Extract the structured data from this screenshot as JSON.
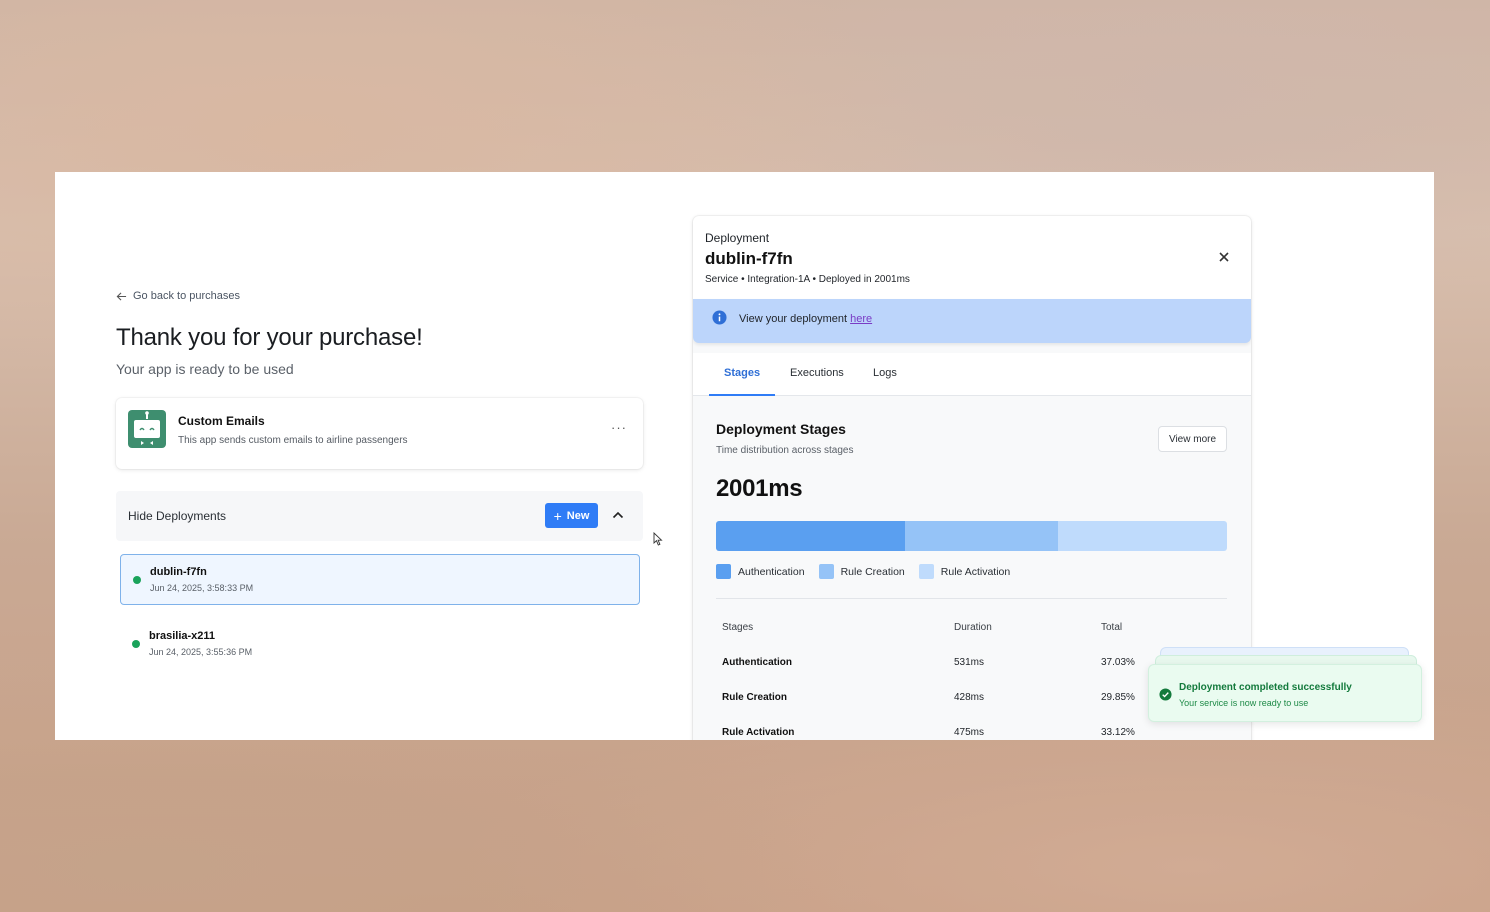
{
  "nav": {
    "back_label": "Go back to purchases"
  },
  "page": {
    "title": "Thank you for your purchase!",
    "subtitle": "Your app is ready to be used"
  },
  "app": {
    "name": "Custom Emails",
    "description": "This app sends custom emails to airline passengers",
    "menu_label": "···",
    "logo_color": "#3e8e6f"
  },
  "deployments": {
    "toggle_label": "Hide Deployments",
    "new_button_label": "New",
    "new_button_icon": "+",
    "items": [
      {
        "name": "dublin-f7fn",
        "date": "Jun 24, 2025, 3:58:33 PM",
        "status_color": "#1aa35b",
        "selected": true
      },
      {
        "name": "brasilia-x211",
        "date": "Jun 24, 2025, 3:55:36 PM",
        "status_color": "#1aa35b",
        "selected": false
      }
    ]
  },
  "panel": {
    "kicker": "Deployment",
    "title": "dublin-f7fn",
    "meta": "Service • Integration-1A • Deployed in 2001ms",
    "banner_text": "View your deployment",
    "banner_link": "here",
    "tabs": [
      "Stages",
      "Executions",
      "Logs"
    ],
    "active_tab": "Stages",
    "stages_title": "Deployment Stages",
    "stages_subtitle": "Time distribution across stages",
    "view_more_label": "View more",
    "total": "2001ms",
    "table_headers": [
      "Stages",
      "Duration",
      "Total"
    ],
    "stages": [
      {
        "name": "Authentication",
        "duration": "531ms",
        "total": "37.03%",
        "share": 37.03,
        "color": "#5a9ff0"
      },
      {
        "name": "Rule Creation",
        "duration": "428ms",
        "total": "29.85%",
        "share": 29.85,
        "color": "#95c3f7"
      },
      {
        "name": "Rule Activation",
        "duration": "475ms",
        "total": "33.12%",
        "share": 33.12,
        "color": "#bfdbfc"
      }
    ]
  },
  "toast": {
    "title": "Deployment completed successfully",
    "message": "Your service is now ready to use",
    "accent": "#137a3c"
  },
  "colors": {
    "primary": "#2f7cf6",
    "banner": "#bcd5fb",
    "selected_border": "#7fb2ea"
  }
}
